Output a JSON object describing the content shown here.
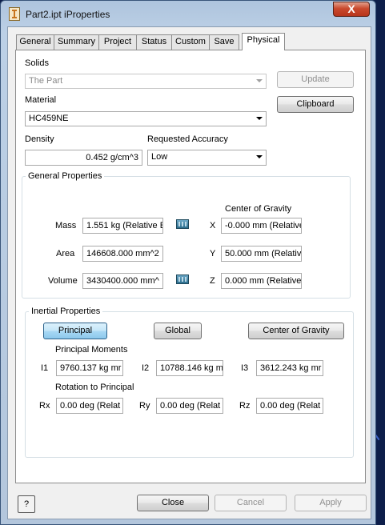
{
  "window": {
    "title": "Part2.ipt iProperties",
    "close_glyph": "X",
    "app_icon": "inventor-part-icon"
  },
  "tabs": [
    {
      "label": "General"
    },
    {
      "label": "Summary"
    },
    {
      "label": "Project"
    },
    {
      "label": "Status"
    },
    {
      "label": "Custom"
    },
    {
      "label": "Save"
    },
    {
      "label": "Physical",
      "active": true
    }
  ],
  "solids": {
    "label": "Solids",
    "value": "The Part"
  },
  "update_button": "Update",
  "clipboard_button": "Clipboard",
  "material": {
    "label": "Material",
    "value": "HC459NE"
  },
  "density": {
    "label": "Density",
    "value": "0.452 g/cm^3"
  },
  "accuracy": {
    "label": "Requested Accuracy",
    "value": "Low"
  },
  "general_properties": {
    "title": "General Properties",
    "center_of_gravity_label": "Center of Gravity",
    "mass": {
      "label": "Mass",
      "value": "1.551 kg (Relative E"
    },
    "area": {
      "label": "Area",
      "value": "146608.000 mm^2"
    },
    "volume": {
      "label": "Volume",
      "value": "3430400.000 mm^"
    },
    "cog_x": {
      "label": "X",
      "value": "-0.000 mm (Relative"
    },
    "cog_y": {
      "label": "Y",
      "value": "50.000 mm (Relativ"
    },
    "cog_z": {
      "label": "Z",
      "value": "0.000 mm (Relative"
    }
  },
  "inertial_properties": {
    "title": "Inertial Properties",
    "principal_button": "Principal",
    "global_button": "Global",
    "cog_button": "Center of Gravity",
    "principal_moments_label": "Principal Moments",
    "i1": {
      "label": "I1",
      "value": "9760.137 kg mr"
    },
    "i2": {
      "label": "I2",
      "value": "10788.146 kg m"
    },
    "i3": {
      "label": "I3",
      "value": "3612.243 kg mr"
    },
    "rotation_label": "Rotation to Principal",
    "rx": {
      "label": "Rx",
      "value": "0.00 deg (Relat"
    },
    "ry": {
      "label": "Ry",
      "value": "0.00 deg (Relat"
    },
    "rz": {
      "label": "Rz",
      "value": "0.00 deg (Relat"
    }
  },
  "footer": {
    "help": "?",
    "close": "Close",
    "cancel": "Cancel",
    "apply": "Apply"
  }
}
